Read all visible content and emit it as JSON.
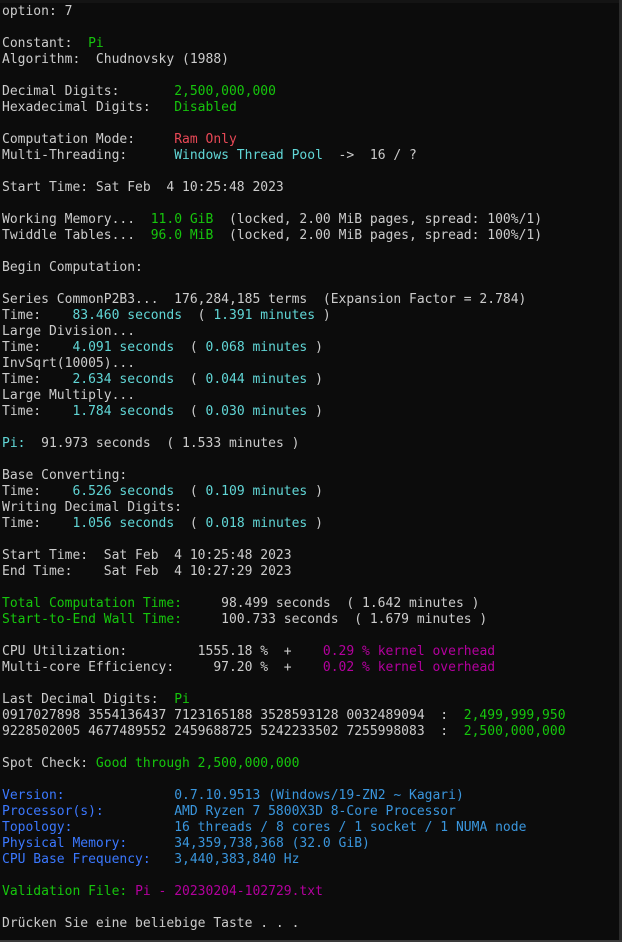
{
  "colors": {
    "background": "#0c0c0c",
    "default_text": "#cccccc",
    "green": "#16c60c",
    "cyan": "#61d6d6",
    "red": "#e74856",
    "blue": "#3b78ff",
    "magenta": "#b4009e",
    "light_blue": "#3a96dd"
  },
  "lines": [
    [
      {
        "t": "option: 7",
        "c": "default"
      }
    ],
    [],
    [
      {
        "t": "Constant:  ",
        "c": "default"
      },
      {
        "t": "Pi",
        "c": "green"
      }
    ],
    [
      {
        "t": "Algorithm:  Chudnovsky (1988)",
        "c": "default"
      }
    ],
    [],
    [
      {
        "t": "Decimal Digits:       ",
        "c": "default"
      },
      {
        "t": "2,500,000,000",
        "c": "green"
      }
    ],
    [
      {
        "t": "Hexadecimal Digits:   ",
        "c": "default"
      },
      {
        "t": "Disabled",
        "c": "green"
      }
    ],
    [],
    [
      {
        "t": "Computation Mode:     ",
        "c": "default"
      },
      {
        "t": "Ram Only",
        "c": "red"
      }
    ],
    [
      {
        "t": "Multi-Threading:      ",
        "c": "default"
      },
      {
        "t": "Windows Thread Pool",
        "c": "cyan"
      },
      {
        "t": "  ->  16 / ?",
        "c": "default"
      }
    ],
    [],
    [
      {
        "t": "Start Time: Sat Feb  4 10:25:48 2023",
        "c": "default"
      }
    ],
    [],
    [
      {
        "t": "Working Memory...  ",
        "c": "default"
      },
      {
        "t": "11.0 GiB",
        "c": "green"
      },
      {
        "t": "  (locked, 2.00 MiB pages, spread: 100%/1)",
        "c": "default"
      }
    ],
    [
      {
        "t": "Twiddle Tables...  ",
        "c": "default"
      },
      {
        "t": "96.0 MiB",
        "c": "green"
      },
      {
        "t": "  (locked, 2.00 MiB pages, spread: 100%/1)",
        "c": "default"
      }
    ],
    [],
    [
      {
        "t": "Begin Computation:",
        "c": "default"
      }
    ],
    [],
    [
      {
        "t": "Series CommonP2B3...  176,284,185 terms  (Expansion Factor = 2.784)",
        "c": "default"
      }
    ],
    [
      {
        "t": "Time:    ",
        "c": "default"
      },
      {
        "t": "83.460 seconds",
        "c": "cyan"
      },
      {
        "t": "  ( ",
        "c": "default"
      },
      {
        "t": "1.391 minutes",
        "c": "cyan"
      },
      {
        "t": " )",
        "c": "default"
      }
    ],
    [
      {
        "t": "Large Division...",
        "c": "default"
      }
    ],
    [
      {
        "t": "Time:    ",
        "c": "default"
      },
      {
        "t": "4.091 seconds",
        "c": "cyan"
      },
      {
        "t": "  ( ",
        "c": "default"
      },
      {
        "t": "0.068 minutes",
        "c": "cyan"
      },
      {
        "t": " )",
        "c": "default"
      }
    ],
    [
      {
        "t": "InvSqrt(10005)...",
        "c": "default"
      }
    ],
    [
      {
        "t": "Time:    ",
        "c": "default"
      },
      {
        "t": "2.634 seconds",
        "c": "cyan"
      },
      {
        "t": "  ( ",
        "c": "default"
      },
      {
        "t": "0.044 minutes",
        "c": "cyan"
      },
      {
        "t": " )",
        "c": "default"
      }
    ],
    [
      {
        "t": "Large Multiply...",
        "c": "default"
      }
    ],
    [
      {
        "t": "Time:    ",
        "c": "default"
      },
      {
        "t": "1.784 seconds",
        "c": "cyan"
      },
      {
        "t": "  ( ",
        "c": "default"
      },
      {
        "t": "0.030 minutes",
        "c": "cyan"
      },
      {
        "t": " )",
        "c": "default"
      }
    ],
    [],
    [
      {
        "t": "Pi:",
        "c": "cyan"
      },
      {
        "t": "  91.973 seconds  ( 1.533 minutes )",
        "c": "default"
      }
    ],
    [],
    [
      {
        "t": "Base Converting:",
        "c": "default"
      }
    ],
    [
      {
        "t": "Time:    ",
        "c": "default"
      },
      {
        "t": "6.526 seconds",
        "c": "cyan"
      },
      {
        "t": "  ( ",
        "c": "default"
      },
      {
        "t": "0.109 minutes",
        "c": "cyan"
      },
      {
        "t": " )",
        "c": "default"
      }
    ],
    [
      {
        "t": "Writing Decimal Digits:",
        "c": "default"
      }
    ],
    [
      {
        "t": "Time:    ",
        "c": "default"
      },
      {
        "t": "1.056 seconds",
        "c": "cyan"
      },
      {
        "t": "  ( ",
        "c": "default"
      },
      {
        "t": "0.018 minutes",
        "c": "cyan"
      },
      {
        "t": " )",
        "c": "default"
      }
    ],
    [],
    [
      {
        "t": "Start Time:  Sat Feb  4 10:25:48 2023",
        "c": "default"
      }
    ],
    [
      {
        "t": "End Time:    Sat Feb  4 10:27:29 2023",
        "c": "default"
      }
    ],
    [],
    [
      {
        "t": "Total Computation Time:",
        "c": "green"
      },
      {
        "t": "     98.499 seconds  ( 1.642 minutes )",
        "c": "default"
      }
    ],
    [
      {
        "t": "Start-to-End Wall Time:",
        "c": "green"
      },
      {
        "t": "     100.733 seconds  ( 1.679 minutes )",
        "c": "default"
      }
    ],
    [],
    [
      {
        "t": "CPU Utilization:         1555.18 %  +    ",
        "c": "default"
      },
      {
        "t": "0.29 % kernel overhead",
        "c": "magenta"
      }
    ],
    [
      {
        "t": "Multi-core Efficiency:     97.20 %  +    ",
        "c": "default"
      },
      {
        "t": "0.02 % kernel overhead",
        "c": "magenta"
      }
    ],
    [],
    [
      {
        "t": "Last Decimal Digits:  ",
        "c": "default"
      },
      {
        "t": "Pi",
        "c": "green"
      }
    ],
    [
      {
        "t": "0917027898 3554136437 7123165188 3528593128 0032489094  :  ",
        "c": "default"
      },
      {
        "t": "2,499,999,950",
        "c": "green"
      }
    ],
    [
      {
        "t": "9228502005 4677489552 2459688725 5242233502 7255998083  :  ",
        "c": "default"
      },
      {
        "t": "2,500,000,000",
        "c": "green"
      }
    ],
    [],
    [
      {
        "t": "Spot Check: ",
        "c": "default"
      },
      {
        "t": "Good through 2,500,000,000",
        "c": "green"
      }
    ],
    [],
    [
      {
        "t": "Version:",
        "c": "blue"
      },
      {
        "t": "              0.7.10.9513 (Windows/19-ZN2 ~ Kagari)",
        "c": "light_blue"
      }
    ],
    [
      {
        "t": "Processor(s):",
        "c": "blue"
      },
      {
        "t": "         AMD Ryzen 7 5800X3D 8-Core Processor",
        "c": "light_blue"
      }
    ],
    [
      {
        "t": "Topology:",
        "c": "blue"
      },
      {
        "t": "             16 threads / 8 cores / 1 socket / 1 NUMA node",
        "c": "light_blue"
      }
    ],
    [
      {
        "t": "Physical Memory:",
        "c": "blue"
      },
      {
        "t": "      34,359,738,368 (32.0 GiB)",
        "c": "light_blue"
      }
    ],
    [
      {
        "t": "CPU Base Frequency:",
        "c": "blue"
      },
      {
        "t": "   3,440,383,840 Hz",
        "c": "light_blue"
      }
    ],
    [],
    [
      {
        "t": "Validation File: ",
        "c": "green"
      },
      {
        "t": "Pi - 20230204-102729.txt",
        "c": "magenta"
      }
    ],
    [],
    [
      {
        "t": "Drücken Sie eine beliebige Taste . . .",
        "c": "default"
      }
    ]
  ]
}
